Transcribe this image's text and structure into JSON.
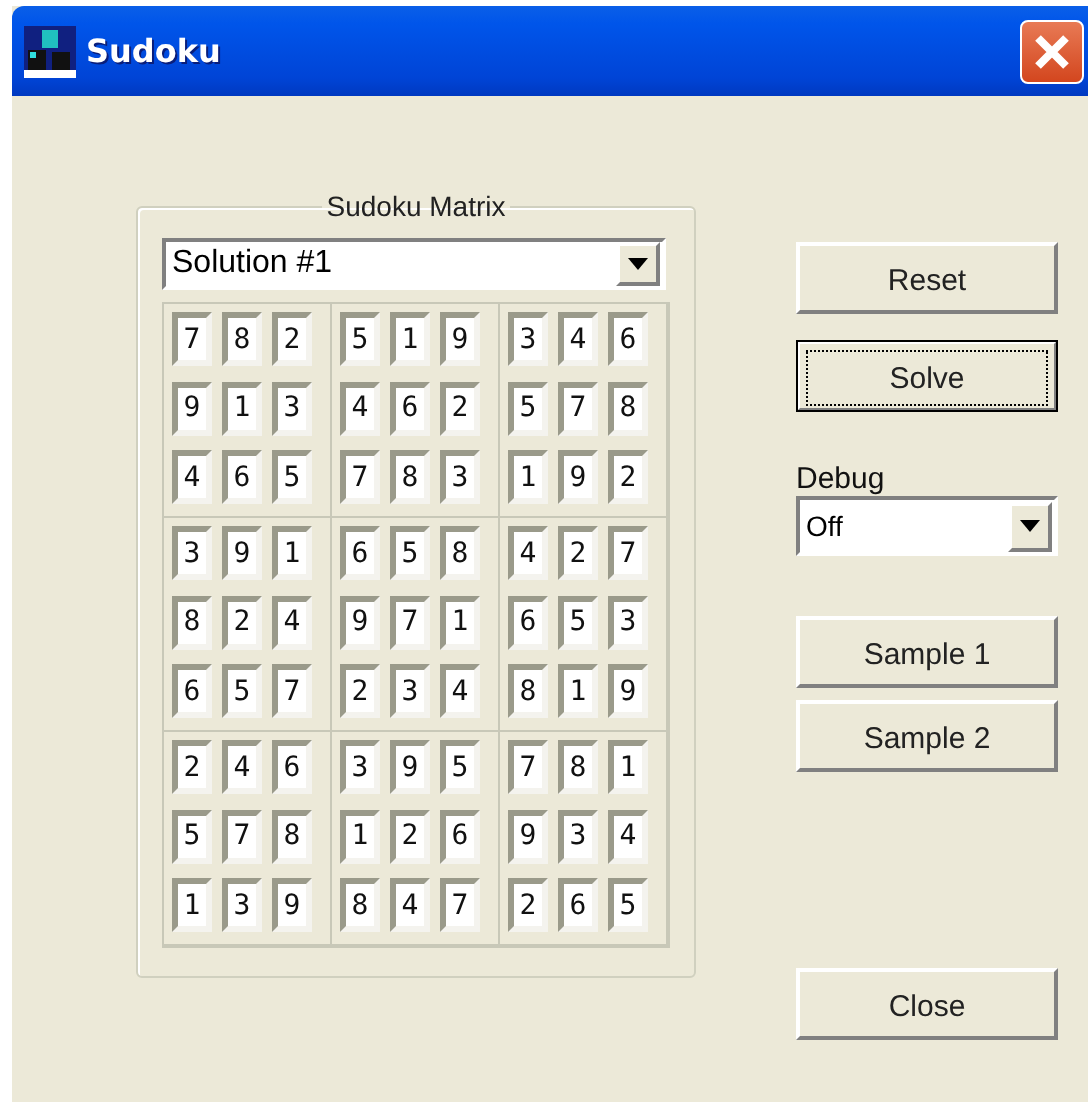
{
  "window": {
    "title": "Sudoku"
  },
  "matrix": {
    "legend": "Sudoku Matrix",
    "solution": "Solution #1",
    "rows": [
      [
        "7",
        "8",
        "2",
        "5",
        "1",
        "9",
        "3",
        "4",
        "6"
      ],
      [
        "9",
        "1",
        "3",
        "4",
        "6",
        "2",
        "5",
        "7",
        "8"
      ],
      [
        "4",
        "6",
        "5",
        "7",
        "8",
        "3",
        "1",
        "9",
        "2"
      ],
      [
        "3",
        "9",
        "1",
        "6",
        "5",
        "8",
        "4",
        "2",
        "7"
      ],
      [
        "8",
        "2",
        "4",
        "9",
        "7",
        "1",
        "6",
        "5",
        "3"
      ],
      [
        "6",
        "5",
        "7",
        "2",
        "3",
        "4",
        "8",
        "1",
        "9"
      ],
      [
        "2",
        "4",
        "6",
        "3",
        "9",
        "5",
        "7",
        "8",
        "1"
      ],
      [
        "5",
        "7",
        "8",
        "1",
        "2",
        "6",
        "9",
        "3",
        "4"
      ],
      [
        "1",
        "3",
        "9",
        "8",
        "4",
        "7",
        "2",
        "6",
        "5"
      ]
    ]
  },
  "controls": [
    {
      "kind": "button",
      "label": "Reset",
      "focused": false
    },
    {
      "kind": "button",
      "label": "Solve",
      "focused": true
    },
    {
      "kind": "select",
      "label": "Debug",
      "value": "Off"
    },
    {
      "kind": "button",
      "label": "Sample 1",
      "focused": false
    },
    {
      "kind": "button",
      "label": "Sample 2",
      "focused": false
    }
  ],
  "close_button": {
    "label": "Close"
  }
}
